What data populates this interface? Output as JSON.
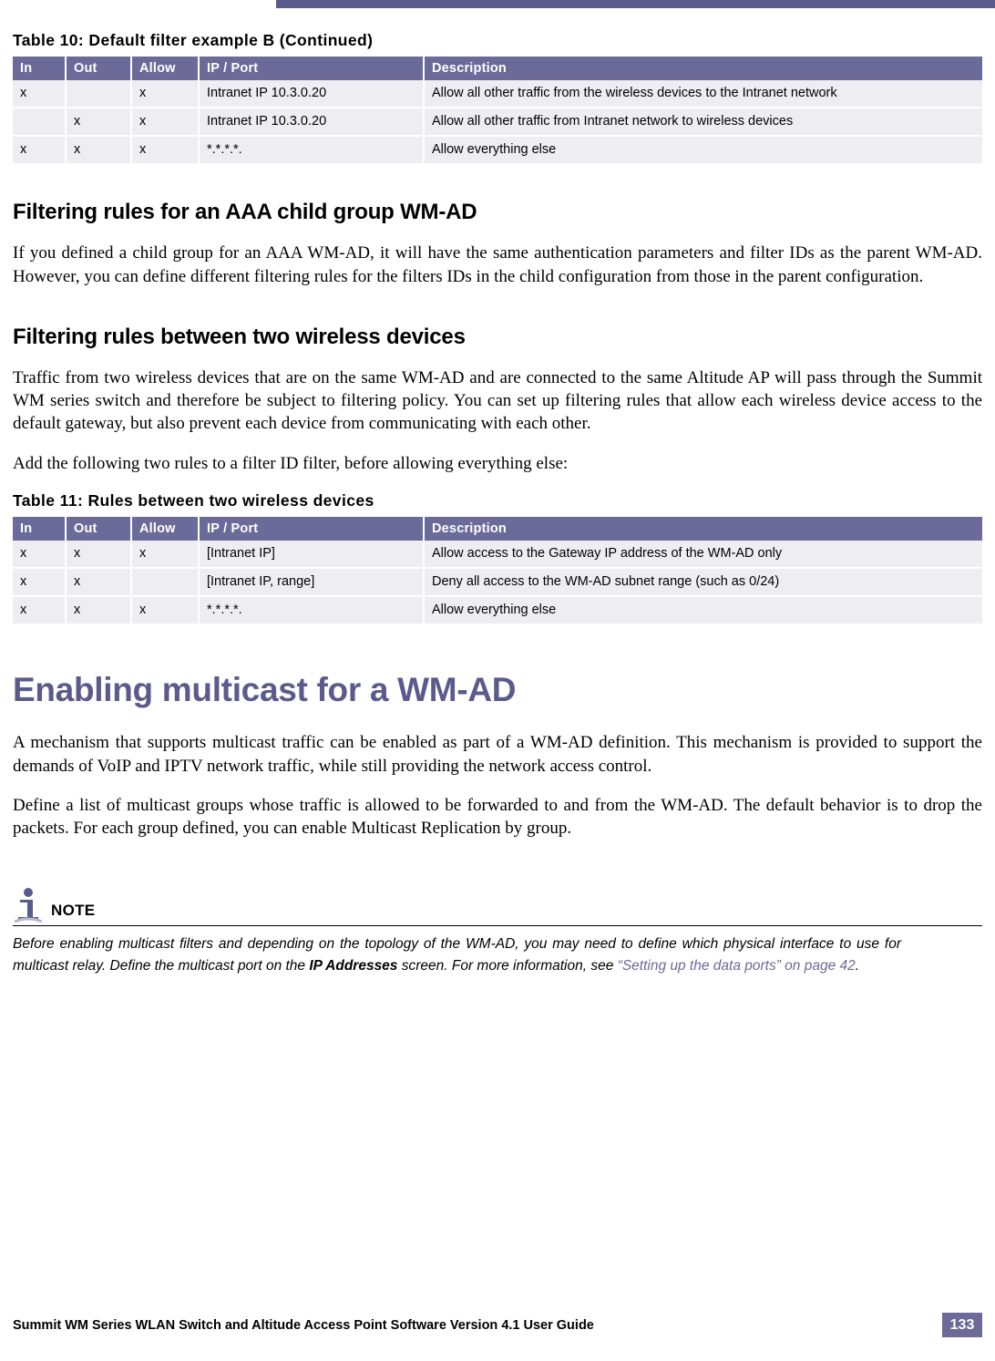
{
  "tables": [
    {
      "caption": "Table 10:  Default filter example B (Continued)",
      "headers": [
        "In",
        "Out",
        "Allow",
        "IP / Port",
        "Description"
      ],
      "rows": [
        [
          "x",
          "",
          "x",
          "Intranet IP 10.3.0.20",
          "Allow all other traffic from the wireless devices to the Intranet network"
        ],
        [
          "",
          "x",
          "x",
          "Intranet IP 10.3.0.20",
          "Allow all other traffic from Intranet network to wireless devices"
        ],
        [
          "x",
          "x",
          "x",
          "*.*.*.*.",
          "Allow everything else"
        ]
      ]
    },
    {
      "caption": "Table 11:  Rules between two wireless devices",
      "headers": [
        "In",
        "Out",
        "Allow",
        "IP / Port",
        "Description"
      ],
      "rows": [
        [
          "x",
          "x",
          "x",
          "[Intranet IP]",
          "Allow access to the Gateway IP address of the WM-AD only"
        ],
        [
          "x",
          "x",
          "",
          "[Intranet IP, range]",
          "Deny all access to the WM-AD subnet range (such as 0/24)"
        ],
        [
          "x",
          "x",
          "x",
          "*.*.*.*.",
          "Allow everything else"
        ]
      ]
    }
  ],
  "sections": [
    {
      "heading": "Filtering rules for an AAA child group WM-AD",
      "paragraphs": [
        "If you defined a child group for an AAA WM-AD, it will have the same authentication parameters and filter IDs as the parent WM-AD. However, you can define different filtering rules for the filters IDs in the child configuration from those in the parent configuration."
      ]
    },
    {
      "heading": "Filtering rules between two wireless devices",
      "paragraphs": [
        "Traffic from two wireless devices that are on the same WM-AD and are connected to the same Altitude AP will pass through the Summit WM series switch and therefore be subject to filtering policy. You can set up filtering rules that allow each wireless device access to the default gateway, but also prevent each device from communicating with each other.",
        "Add the following two rules to a filter ID filter, before allowing everything else:"
      ]
    }
  ],
  "chapter": {
    "heading": "Enabling multicast for a WM-AD",
    "paragraphs": [
      "A mechanism that supports multicast traffic can be enabled as part of a WM-AD definition. This mechanism is provided to support the demands of VoIP and IPTV network traffic, while still providing the network access control.",
      "Define a list of multicast groups whose traffic is allowed to be forwarded to and from the WM-AD. The default behavior is to drop the packets. For each group defined, you can enable Multicast Replication by group."
    ]
  },
  "note": {
    "label": "NOTE",
    "icon": "info-icon",
    "text_part1": "Before enabling multicast filters and depending on the topology of the WM-AD, you may need to define which physical interface to use for multicast relay. Define the multicast port on the ",
    "bold": "IP Addresses",
    "text_part2": " screen. For more information, see ",
    "link": "“Setting up the data ports” on page 42",
    "text_part3": "."
  },
  "footer": {
    "text": "Summit WM Series WLAN Switch and Altitude Access Point Software Version 4.1 User Guide",
    "page": "133"
  },
  "colors": {
    "accent": "#5b5a8c",
    "table_header": "#6b6a99",
    "table_cell": "#eeedf2"
  }
}
